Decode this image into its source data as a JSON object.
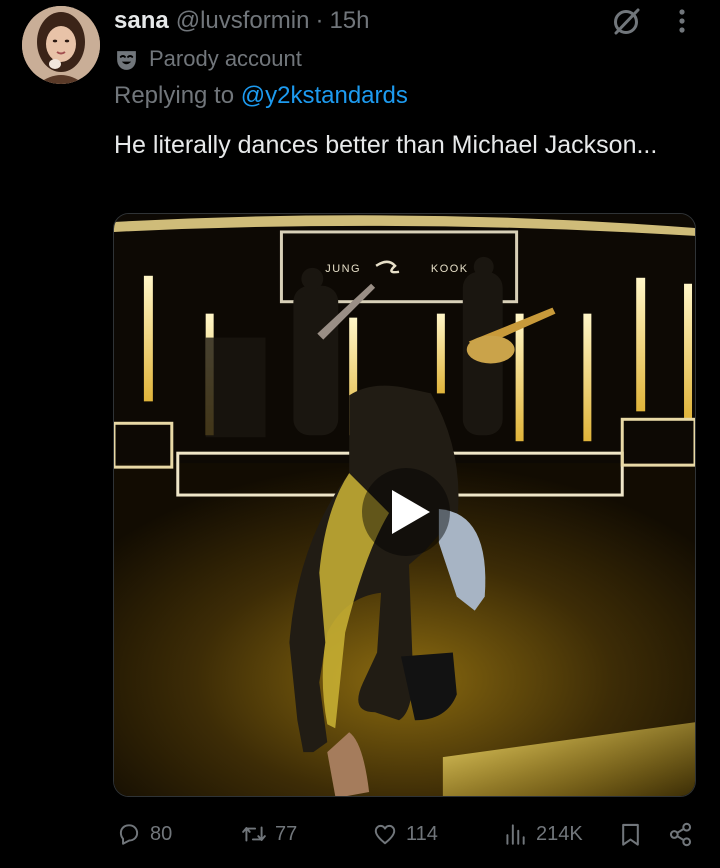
{
  "tweet": {
    "author_name": "sana",
    "author_handle": "@luvsformin",
    "separator": "·",
    "time": "15h",
    "parody_label": "Parody account",
    "replying_prefix": "Replying to",
    "replying_to": "@y2kstandards",
    "text": "He literally dances better than Michael Jackson...",
    "video_sign_left": "JUNG",
    "video_sign_right": "KOOK"
  },
  "actions": {
    "replies": "80",
    "reposts": "77",
    "likes": "114",
    "views": "214K"
  },
  "icons": {
    "grok": "grok-icon",
    "more": "more-icon",
    "parody": "mask-icon",
    "reply": "reply-icon",
    "repost": "repost-icon",
    "like": "heart-icon",
    "views": "views-icon",
    "bookmark": "bookmark-icon",
    "share": "share-icon",
    "play": "play-icon"
  },
  "colors": {
    "background": "#000000",
    "text": "#e7e9ea",
    "muted": "#71767b",
    "link": "#1d9bf0"
  }
}
